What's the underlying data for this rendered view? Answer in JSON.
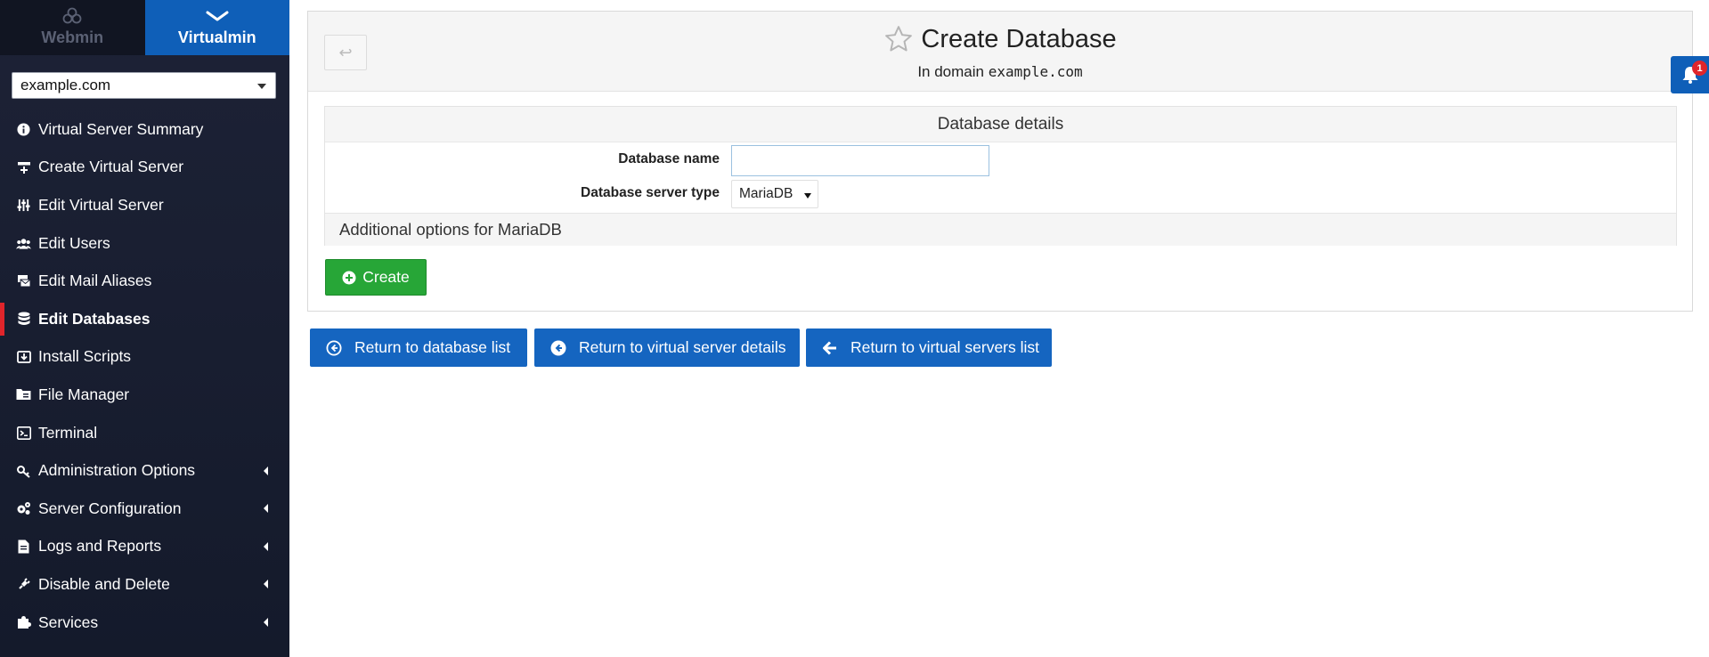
{
  "switcher": {
    "webmin_label": "Webmin",
    "virtualmin_label": "Virtualmin"
  },
  "domain_select": {
    "value": "example.com"
  },
  "nav": {
    "items": [
      {
        "label": "Virtual Server Summary",
        "icon": "info-circle-icon"
      },
      {
        "label": "Create Virtual Server",
        "icon": "server-plus-icon"
      },
      {
        "label": "Edit Virtual Server",
        "icon": "sliders-icon"
      },
      {
        "label": "Edit Users",
        "icon": "users-icon"
      },
      {
        "label": "Edit Mail Aliases",
        "icon": "mail-aliases-icon"
      },
      {
        "label": "Edit Databases",
        "icon": "database-icon"
      },
      {
        "label": "Install Scripts",
        "icon": "install-icon"
      },
      {
        "label": "File Manager",
        "icon": "folder-icon"
      },
      {
        "label": "Terminal",
        "icon": "terminal-icon"
      },
      {
        "label": "Administration Options",
        "icon": "key-icon"
      },
      {
        "label": "Server Configuration",
        "icon": "cogs-icon"
      },
      {
        "label": "Logs and Reports",
        "icon": "file-icon"
      },
      {
        "label": "Disable and Delete",
        "icon": "plug-icon"
      },
      {
        "label": "Services",
        "icon": "puzzle-icon"
      }
    ],
    "active_label": "Edit Databases"
  },
  "header": {
    "back_symbol": "↩",
    "title": "Create Database",
    "subtitle_prefix": "In domain",
    "subtitle_domain": "example.com"
  },
  "notifications": {
    "count": "1"
  },
  "form": {
    "section_title": "Database details",
    "db_name_label": "Database name",
    "db_name_value": "",
    "db_type_label": "Database server type",
    "db_type_value": "MariaDB",
    "additional_options": "Additional options for MariaDB"
  },
  "buttons": {
    "create": "Create",
    "return_db_list": "Return to database list",
    "return_vs_details": "Return to virtual server details",
    "return_vs_list": "Return to virtual servers list"
  },
  "colors": {
    "sidebar_bg": "#1d2236",
    "accent_blue": "#1565c0",
    "create_green": "#27a637",
    "active_marker": "#e0252b"
  }
}
